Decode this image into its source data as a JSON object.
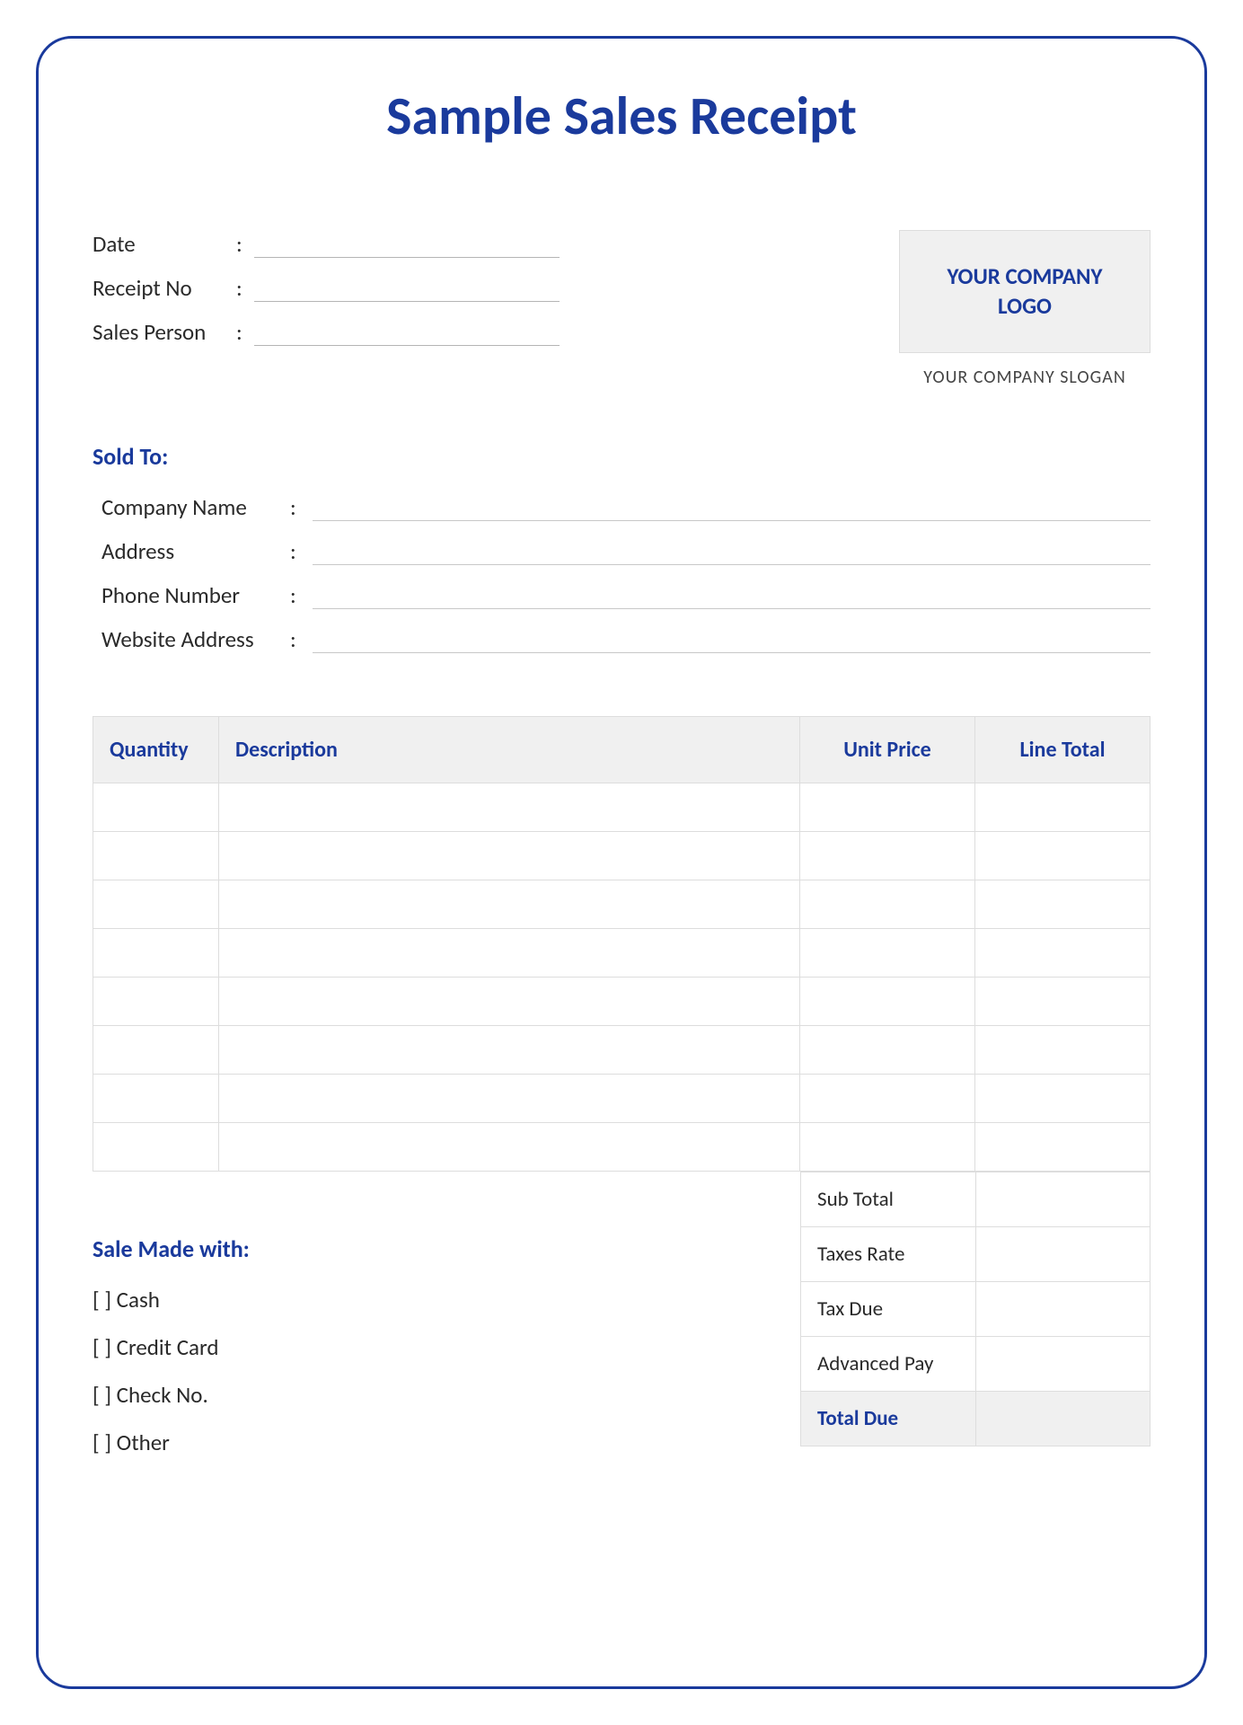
{
  "title": "Sample Sales Receipt",
  "header": {
    "fields": [
      {
        "label": "Date"
      },
      {
        "label": "Receipt No"
      },
      {
        "label": "Sales Person"
      }
    ],
    "logo_line1": "YOUR COMPANY",
    "logo_line2": "LOGO",
    "slogan": "YOUR COMPANY SLOGAN"
  },
  "sold_to": {
    "title": "Sold To:",
    "fields": [
      {
        "label": "Company Name"
      },
      {
        "label": "Address"
      },
      {
        "label": "Phone Number"
      },
      {
        "label": "Website Address"
      }
    ]
  },
  "items_table": {
    "columns": [
      "Quantity",
      "Description",
      "Unit Price",
      "Line Total"
    ],
    "row_count": 8
  },
  "payment": {
    "title": "Sale Made with:",
    "options": [
      "Cash",
      "Credit Card",
      "Check No.",
      "Other"
    ]
  },
  "totals": {
    "rows": [
      "Sub Total",
      "Taxes  Rate",
      "Tax  Due",
      "Advanced Pay"
    ],
    "total_label": "Total  Due"
  }
}
